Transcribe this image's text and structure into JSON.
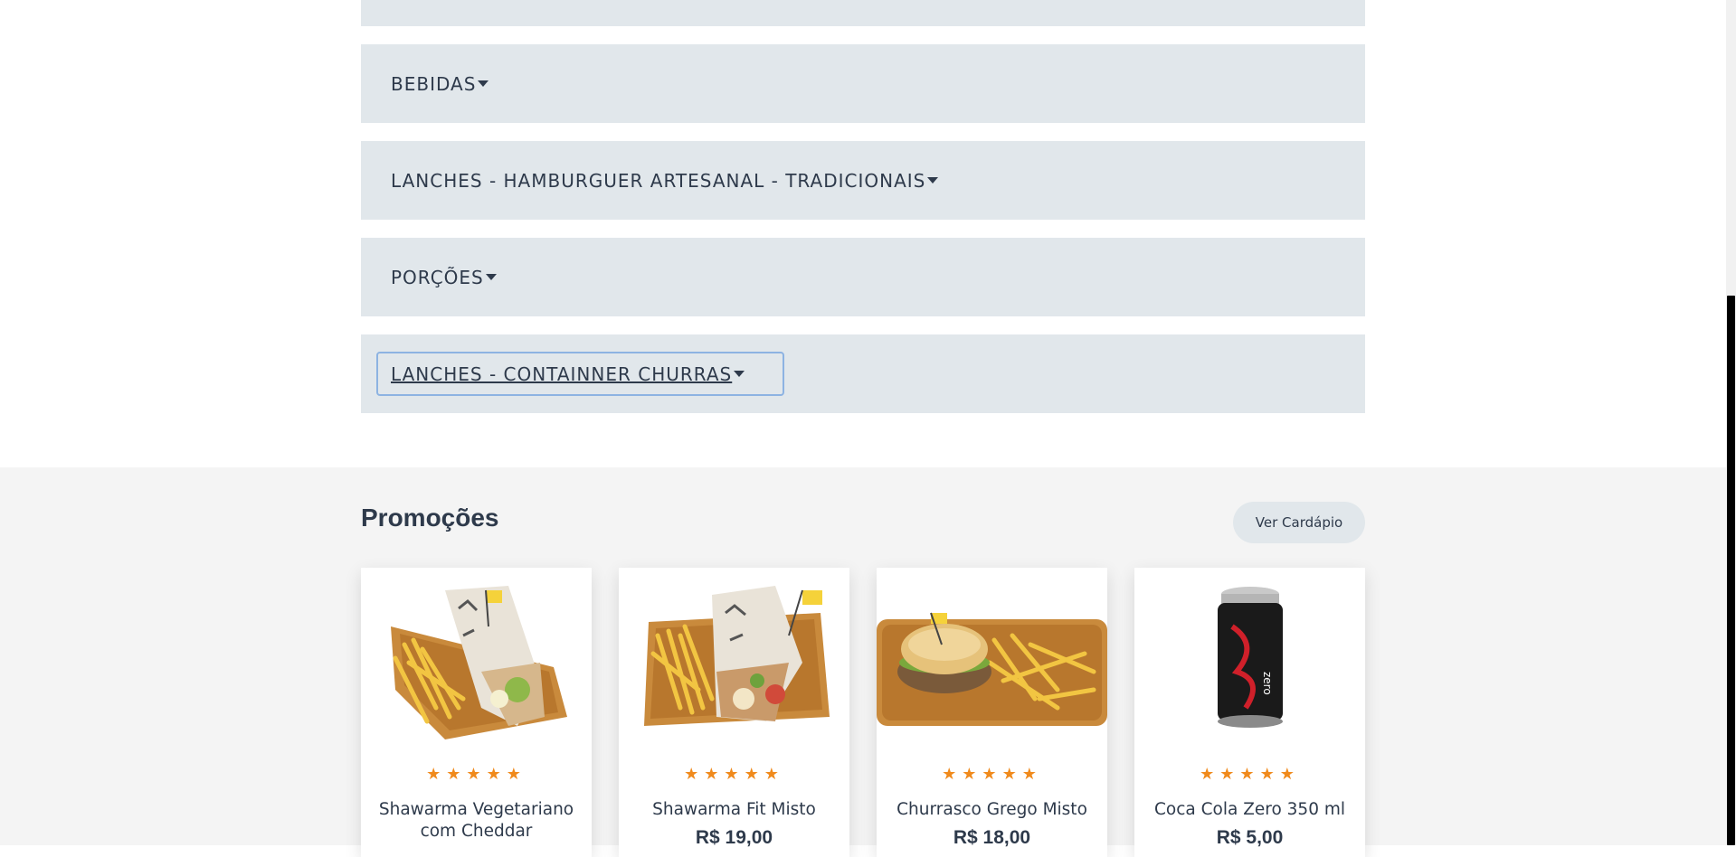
{
  "categories": [
    {
      "label": ""
    },
    {
      "label": "BEBIDAS"
    },
    {
      "label": "LANCHES - HAMBURGUER ARTESANAL - TRADICIONAIS"
    },
    {
      "label": "PORÇÕES"
    },
    {
      "label": "LANCHES - CONTAINNER CHURRAS"
    }
  ],
  "promotions": {
    "title": "Promoções",
    "menu_button": "Ver Cardápio",
    "items": [
      {
        "name": "Shawarma Vegetariano com Cheddar",
        "price": "",
        "rating": 5,
        "image": "wrap-with-fries-image"
      },
      {
        "name": "Shawarma Fit Misto",
        "price": "R$ 19,00",
        "rating": 5,
        "image": "wrap-with-fries-image"
      },
      {
        "name": "Churrasco Grego Misto",
        "price": "R$ 18,00",
        "rating": 5,
        "image": "sandwich-with-fries-image"
      },
      {
        "name": "Coca Cola Zero 350 ml",
        "price": "R$ 5,00",
        "rating": 5,
        "image": "soda-can-image"
      }
    ]
  },
  "colors": {
    "accent_star": "#f08a1c",
    "text": "#2e3a4b",
    "category_bg": "#e1e7eb",
    "focus_ring": "#8db3e2"
  }
}
